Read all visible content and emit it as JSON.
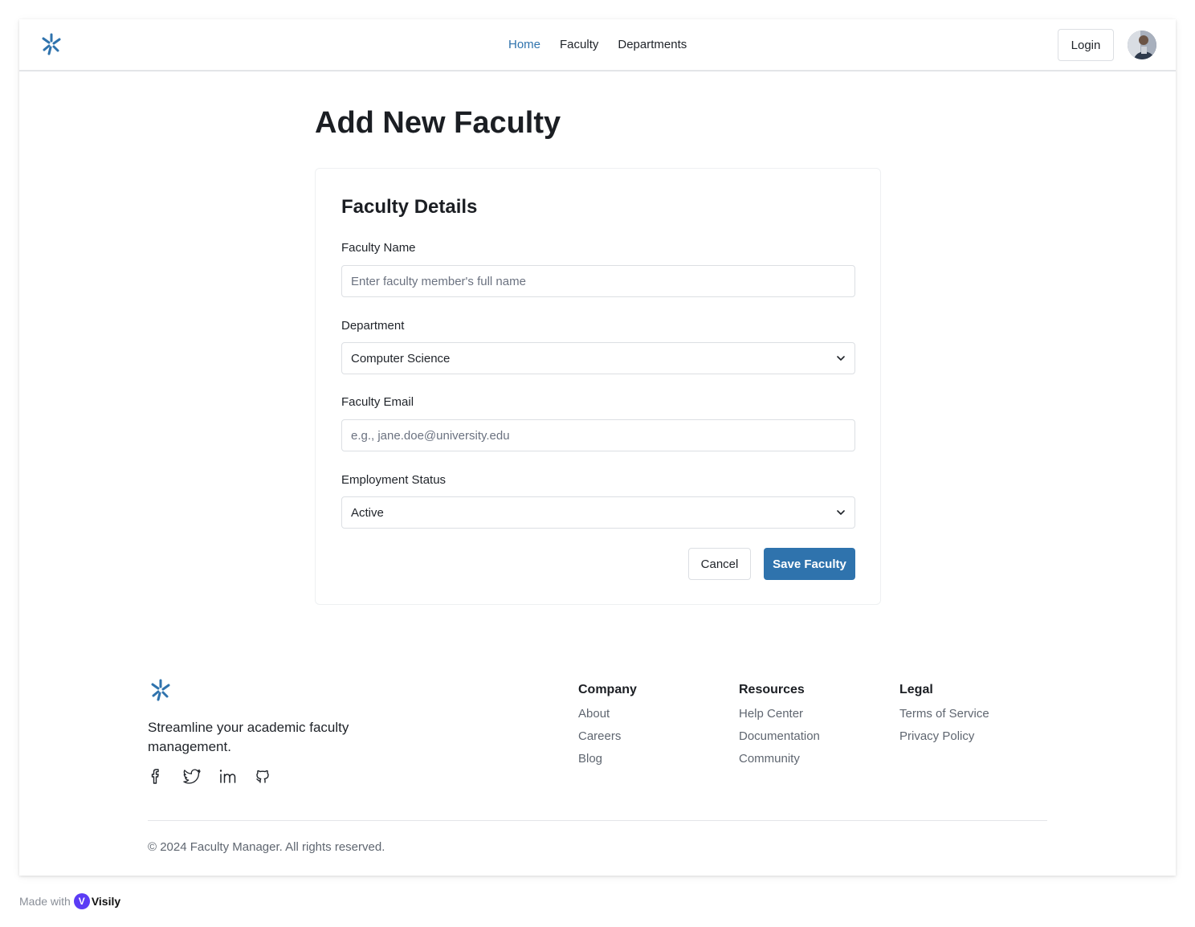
{
  "colors": {
    "accent": "#2f73ad",
    "text": "#1f2329",
    "muted": "#5f6670",
    "border": "#dcdfe3"
  },
  "header": {
    "logo_icon": "asterisk-logo-icon",
    "nav": [
      {
        "label": "Home",
        "active": true
      },
      {
        "label": "Faculty",
        "active": false
      },
      {
        "label": "Departments",
        "active": false
      }
    ],
    "login_label": "Login",
    "avatar_icon": "user-avatar"
  },
  "main": {
    "title": "Add New Faculty",
    "card": {
      "title": "Faculty Details",
      "fields": {
        "name": {
          "label": "Faculty Name",
          "placeholder": "Enter faculty member's full name",
          "value": ""
        },
        "department": {
          "label": "Department",
          "value": "Computer Science"
        },
        "email": {
          "label": "Faculty Email",
          "placeholder": "e.g., jane.doe@university.edu",
          "value": ""
        },
        "status": {
          "label": "Employment Status",
          "value": "Active"
        }
      },
      "cancel_label": "Cancel",
      "save_label": "Save Faculty"
    }
  },
  "footer": {
    "tagline": "Streamline your academic faculty management.",
    "socials": [
      "facebook-icon",
      "twitter-icon",
      "linkedin-icon",
      "github-icon"
    ],
    "columns": [
      {
        "heading": "Company",
        "links": [
          "About",
          "Careers",
          "Blog"
        ]
      },
      {
        "heading": "Resources",
        "links": [
          "Help Center",
          "Documentation",
          "Community"
        ]
      },
      {
        "heading": "Legal",
        "links": [
          "Terms of Service",
          "Privacy Policy"
        ]
      }
    ],
    "copyright": "© 2024 Faculty Manager. All rights reserved."
  },
  "made_with": {
    "prefix": "Made with",
    "brand": "Visily"
  }
}
